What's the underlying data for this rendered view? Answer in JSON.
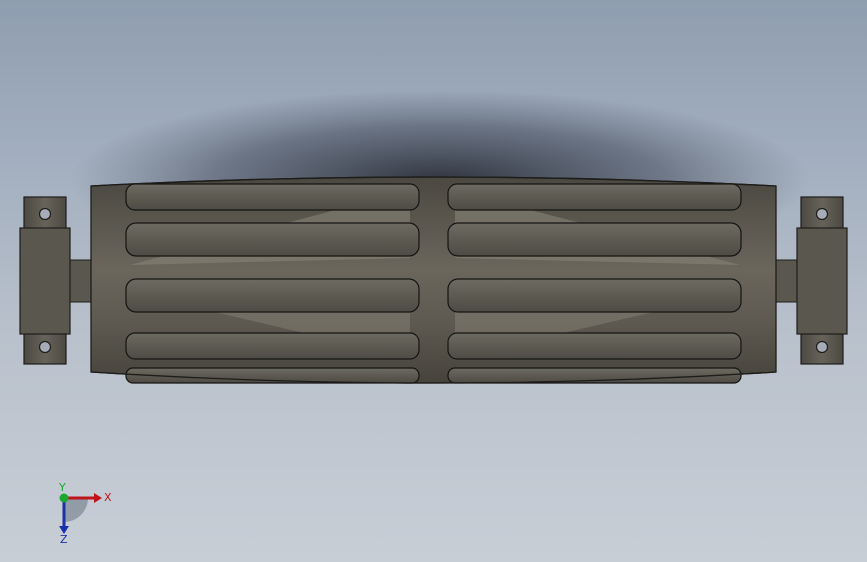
{
  "viewport": {
    "model": "roller-conveyor-drum-assembly",
    "colors": {
      "background_top": "#8f9db0",
      "background_bottom": "#c8ced6",
      "body": "#5f5b52",
      "body_dark": "#3f3c36",
      "body_light": "#7a766b",
      "edge": "#1e1d1a"
    }
  },
  "triad": {
    "x_label": "X",
    "y_label": "Y",
    "z_label": "Z",
    "x_color": "#c0141c",
    "y_color": "#1aa830",
    "z_color": "#1c2fa8"
  }
}
